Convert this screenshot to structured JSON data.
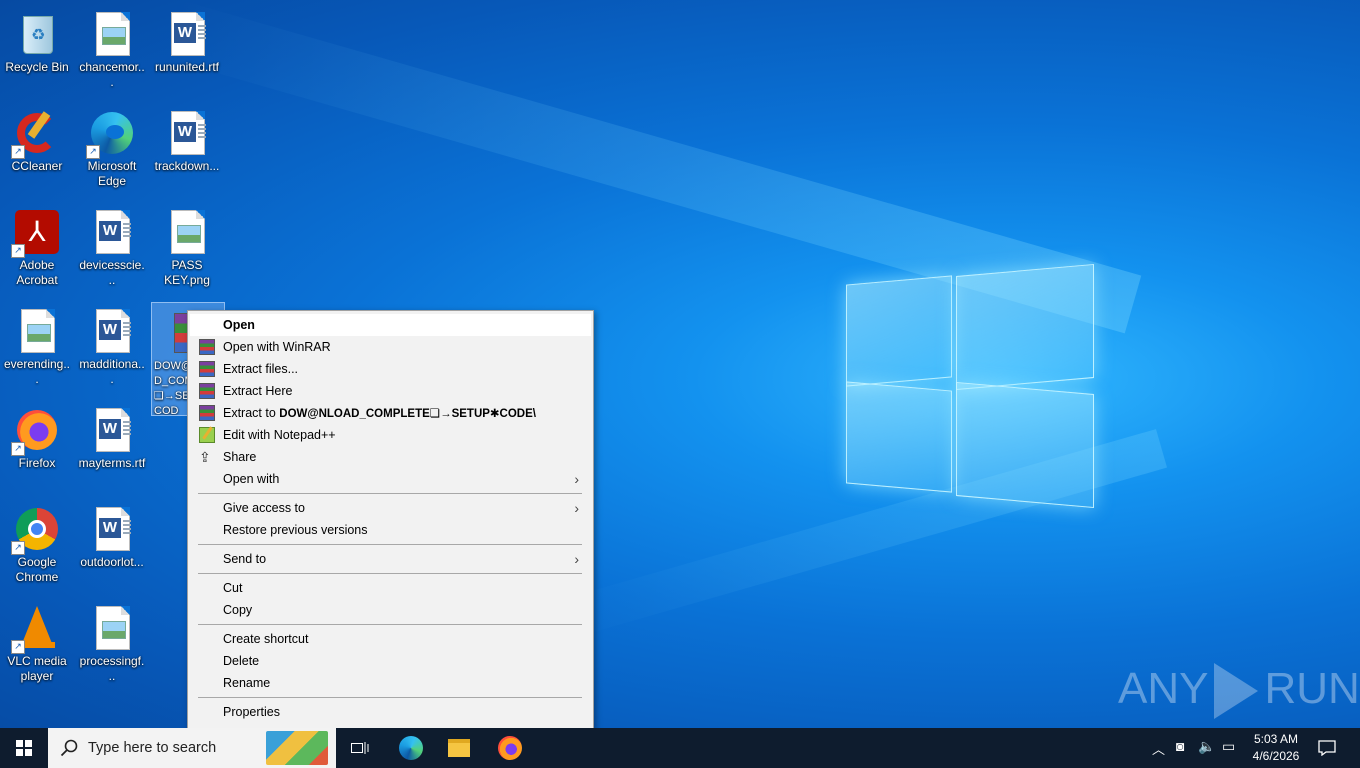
{
  "desktop": {
    "icons": [
      {
        "label": "Recycle Bin"
      },
      {
        "label": "chancemor..."
      },
      {
        "label": "rununited.rtf"
      },
      {
        "label": "CCleaner"
      },
      {
        "label": "Microsoft Edge"
      },
      {
        "label": "trackdown..."
      },
      {
        "label": "Adobe Acrobat"
      },
      {
        "label": "devicesscie..."
      },
      {
        "label": "PASS KEY.png"
      },
      {
        "label": "everending..."
      },
      {
        "label": "madditiona..."
      },
      {
        "label": "DOW@NLOAD_COMPLETE❏→SETUP✱CODE"
      },
      {
        "label": "Firefox"
      },
      {
        "label": "mayterms.rtf"
      },
      {
        "label": "Google Chrome"
      },
      {
        "label": "outdoorlot..."
      },
      {
        "label": "VLC media player"
      },
      {
        "label": "processingf..."
      }
    ],
    "selected_label_lines": [
      "DOW@",
      "D_COM",
      "❏→SE",
      "COD"
    ]
  },
  "context_menu": {
    "items": [
      {
        "label": "Open",
        "icon": "none"
      },
      {
        "label": "Open with WinRAR",
        "icon": "winrar-icon"
      },
      {
        "label": "Extract files...",
        "icon": "winrar-icon"
      },
      {
        "label": "Extract Here",
        "icon": "winrar-icon"
      },
      {
        "label": "Extract to ",
        "bold_part": "DOW@NLOAD_COMPLETE❏→SETUP✱CODE\\",
        "icon": "winrar-icon"
      },
      {
        "label": "Edit with Notepad++",
        "icon": "notepadpp-icon"
      },
      {
        "label": "Share",
        "icon": "share-icon"
      },
      {
        "label": "Open with",
        "icon": "none"
      },
      {
        "label": "Give access to",
        "icon": "none"
      },
      {
        "label": "Restore previous versions",
        "icon": "none"
      },
      {
        "label": "Send to",
        "icon": "none"
      },
      {
        "label": "Cut",
        "icon": "none"
      },
      {
        "label": "Copy",
        "icon": "none"
      },
      {
        "label": "Create shortcut",
        "icon": "none"
      },
      {
        "label": "Delete",
        "icon": "none"
      },
      {
        "label": "Rename",
        "icon": "none"
      },
      {
        "label": "Properties",
        "icon": "none"
      }
    ],
    "submenu_arrow": "›"
  },
  "taskbar": {
    "search_placeholder": "Type here to search",
    "time": "5:03 AM",
    "date": "4/6/2026"
  },
  "watermark": {
    "left": "ANY",
    "right": "RUN"
  },
  "colors": {
    "accent": "#0078d7",
    "taskbar": "#0e1c2e",
    "menu_bg": "#f2f2f2"
  }
}
